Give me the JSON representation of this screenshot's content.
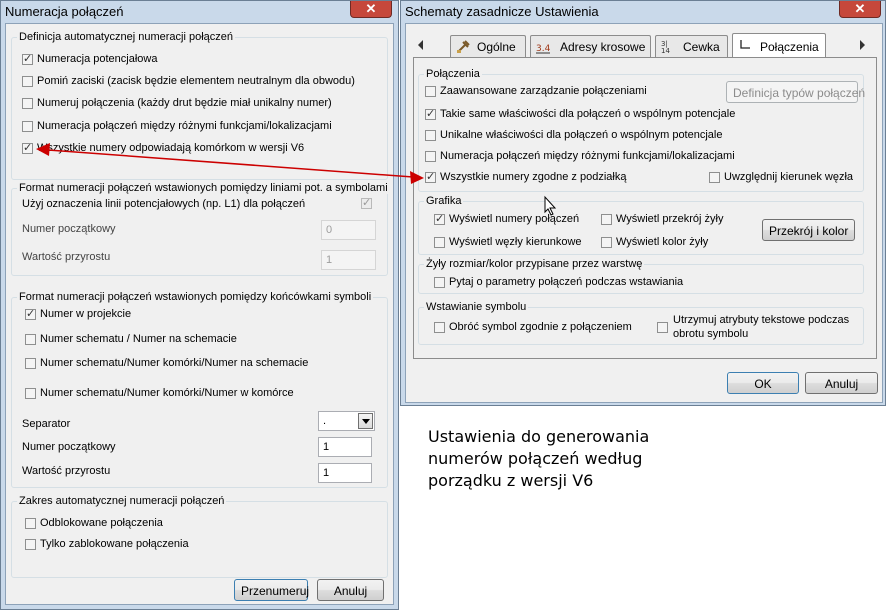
{
  "left_dialog": {
    "title": "Numeracja połączeń",
    "close_label": "✕",
    "group_definition": {
      "title": "Definicja automatycznej numeracji połączeń",
      "options": [
        {
          "label": "Numeracja potencjałowa",
          "checked": true
        },
        {
          "label": "Pomiń zaciski (zacisk będzie elementem neutralnym dla obwodu)",
          "checked": false
        },
        {
          "label": "Numeruj połączenia (każdy drut będzie miał unikalny numer)",
          "checked": false
        },
        {
          "label": "Numeracja połączeń między różnymi funkcjami/lokalizacjami",
          "checked": false
        },
        {
          "label": "Wszystkie numery odpowiadają komórkom w wersji V6",
          "checked": true
        }
      ]
    },
    "group_potential": {
      "title": "Format numeracji połączeń wstawionych pomiędzy liniami pot. a symbolami",
      "use_label": "Użyj oznaczenia linii potencjałowych (np. L1) dla połączeń",
      "use_checked": true,
      "start_label": "Numer początkowy",
      "start_value": "0",
      "increment_label": "Wartość przyrostu",
      "increment_value": "1"
    },
    "group_endpoints": {
      "title": "Format numeracji połączeń wstawionych pomiędzy końcówkami symboli",
      "options": [
        {
          "label": "Numer w projekcie",
          "checked": true
        },
        {
          "label": "Numer schematu / Numer na schemacie",
          "checked": false
        },
        {
          "label": "Numer schematu/Numer komórki/Numer na schemacie",
          "checked": false
        },
        {
          "label": "Numer schematu/Numer komórki/Numer w komórce",
          "checked": false
        }
      ],
      "separator_label": "Separator",
      "separator_value": ".",
      "start_label": "Numer początkowy",
      "start_value": "1",
      "increment_label": "Wartość przyrostu",
      "increment_value": "1"
    },
    "group_scope": {
      "title": "Zakres automatycznej numeracji połączeń",
      "options": [
        {
          "label": "Odblokowane połączenia",
          "checked": false
        },
        {
          "label": "Tylko zablokowane połączenia",
          "checked": false
        }
      ]
    },
    "renumber_button": "Przenumeruj",
    "cancel_button": "Anuluj"
  },
  "right_dialog": {
    "title": "Schematy zasadnicze Ustawienia",
    "close_label": "✕",
    "tabs": [
      {
        "label": "Ogólne",
        "icon": "ogolne-tab-icon"
      },
      {
        "label": "Adresy krosowe",
        "icon": "cross-reference-tab-icon"
      },
      {
        "label": "Cewka",
        "icon": "coil-tab-icon"
      },
      {
        "label": "Połączenia",
        "icon": "wire-tab-icon",
        "active": true
      }
    ],
    "group_connections": {
      "title": "Połączenia",
      "advanced_label": "Zaawansowane zarządzanie połączeniami",
      "advanced_checked": false,
      "define_types_button": "Definicja typów połączeń",
      "same_props_label": "Takie same właściwości dla połączeń o wspólnym potencjale",
      "same_props_checked": true,
      "unique_props_label": "Unikalne właściwości dla  połączeń o wspólnym potencjale",
      "unique_props_checked": false,
      "between_functions_label": "Numeracja połączeń między różnymi funkcjami/lokalizacjami",
      "between_functions_checked": false,
      "match_grid_label": "Wszystkie numery zgodne z podziałką",
      "match_grid_checked": true,
      "node_direction_label": "Uwzględnij kierunek węzła",
      "node_direction_checked": false
    },
    "group_graphics": {
      "title": "Grafika",
      "show_numbers_label": "Wyświetl numery połączeń",
      "show_numbers_checked": true,
      "show_cross_section_label": "Wyświetl przekrój żyły",
      "show_cross_section_checked": false,
      "show_direction_nodes_label": "Wyświetl węzły kierunkowe",
      "show_direction_nodes_checked": false,
      "show_wire_color_label": "Wyświetl kolor żyły",
      "show_wire_color_checked": false,
      "cross_section_button": "Przekrój i kolor"
    },
    "group_wire_size": {
      "title": "Żyły rozmiar/kolor przypisane przez warstwę",
      "ask_label": "Pytaj o parametry połączeń podczas wstawiania",
      "ask_checked": false
    },
    "group_symbol_insert": {
      "title": "Wstawianie symbolu",
      "rotate_label": "Obróć symbol zgodnie z połączeniem",
      "rotate_checked": false,
      "keep_attrs_label_1": "Utrzymuj atrybuty tekstowe podczas",
      "keep_attrs_label_2": "obrotu symbolu",
      "keep_attrs_checked": false
    },
    "ok_button": "OK",
    "cancel_button": "Anuluj"
  },
  "caption": {
    "line1": "Ustawienia do generowania",
    "line2": "numerów połączeń według",
    "line3": "porządku z wersji V6"
  },
  "colors": {
    "window_frame": "#c9d9ea",
    "dialog_face": "#f0f0f0",
    "arrow": "#cc0000",
    "close_button": "#c6483b"
  }
}
